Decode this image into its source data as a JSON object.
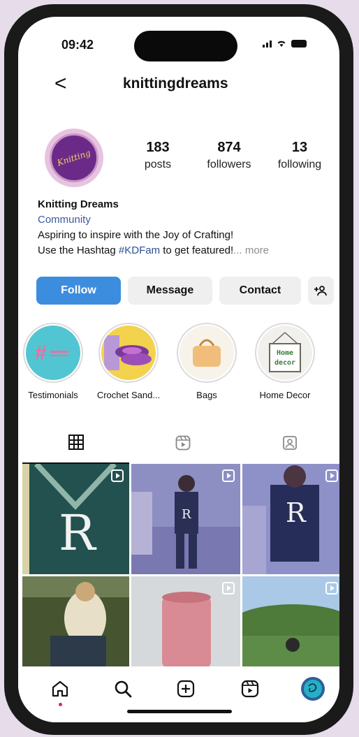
{
  "status": {
    "time": "09:42"
  },
  "header": {
    "back_glyph": "<",
    "username": "knittingdreams"
  },
  "avatar": {
    "logo_text": "Knitting"
  },
  "stats": [
    {
      "value": "183",
      "label": "posts"
    },
    {
      "value": "874",
      "label": "followers"
    },
    {
      "value": "13",
      "label": "following"
    }
  ],
  "bio": {
    "name": "Knitting Dreams",
    "category": "Community",
    "line1": "Aspiring to inspire with the Joy of Crafting!",
    "line2_prefix": "Use the Hashtag ",
    "hashtag": "#KDFam",
    "line2_suffix": " to get featured!",
    "more": "... more"
  },
  "buttons": {
    "follow": "Follow",
    "message": "Message",
    "contact": "Contact"
  },
  "highlights": [
    {
      "label": "Testimonials",
      "icon": "hashtag-icon"
    },
    {
      "label": "Crochet Sand...",
      "icon": "sandals-icon"
    },
    {
      "label": "Bags",
      "icon": "bag-icon"
    },
    {
      "label": "Home Decor",
      "icon": "home-decor-sign-icon"
    }
  ],
  "home_decor_sign": {
    "line1": "Home",
    "line2": "decor"
  },
  "posts": [
    {
      "letter": "R"
    },
    {
      "letter": "R"
    },
    {
      "letter": "R"
    }
  ],
  "colors": {
    "follow": "#3d8ddf",
    "accent": "#2c4f94",
    "notification": "#e0245e"
  }
}
